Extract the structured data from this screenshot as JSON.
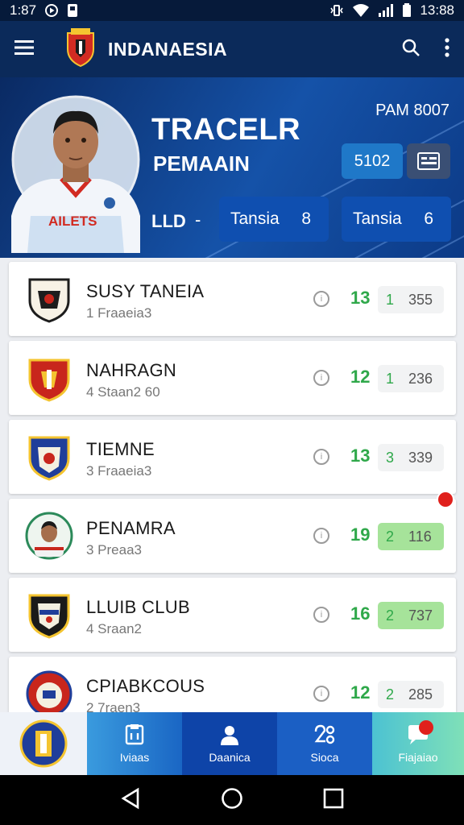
{
  "status_bar": {
    "time_left": "1:87",
    "time_right": "13:88"
  },
  "app_bar": {
    "title": "INDANAESIA"
  },
  "hero": {
    "name": "TRACELR",
    "role": "PEMAAIN",
    "meta": "PAM 8007",
    "score_chip": "5102",
    "lvl_label": "LLD",
    "dash": "-",
    "tab1": {
      "label": "Tansia",
      "value": "8"
    },
    "tab2": {
      "label": "Tansia",
      "value": "6"
    },
    "jersey_text": "AILETS"
  },
  "cards": [
    {
      "title": "SUSY TANEIA",
      "sub": "1 Fraaeia3",
      "rank": "13",
      "n": "1",
      "value": "355",
      "highlight": false,
      "badge_color": "#1d1d1d"
    },
    {
      "title": "NAHRAGN",
      "sub": "4 Staan2 60",
      "rank": "12",
      "n": "1",
      "value": "236",
      "highlight": false,
      "badge_color": "#c8261c"
    },
    {
      "title": "TIEMNE",
      "sub": "3 Fraaeia3",
      "rank": "13",
      "n": "3",
      "value": "339",
      "highlight": false,
      "badge_color": "#1f3e9a"
    },
    {
      "title": "PENAMRA",
      "sub": "3 Preaa3",
      "rank": "19",
      "n": "2",
      "value": "116",
      "highlight": true,
      "badge_color": "#2c8a5a"
    },
    {
      "title": "LLUIB CLUB",
      "sub": "4 Sraan2",
      "rank": "16",
      "n": "2",
      "value": "737",
      "highlight": true,
      "badge_color": "#1a1a1a"
    },
    {
      "title": "CPIABKCOUS",
      "sub": "2 7raen3",
      "rank": "12",
      "n": "2",
      "value": "285",
      "highlight": false,
      "badge_color": "#c8261c"
    }
  ],
  "bottom_nav": [
    {
      "label": ""
    },
    {
      "label": "Iviaas"
    },
    {
      "label": "Daanica"
    },
    {
      "label": "Sioca"
    },
    {
      "label": "Fiajaiao"
    }
  ],
  "colors": {
    "accent": "#0f4fb0",
    "rank_green": "#2fa84a",
    "highlight": "#a6e39a",
    "alert": "#e0201c"
  }
}
